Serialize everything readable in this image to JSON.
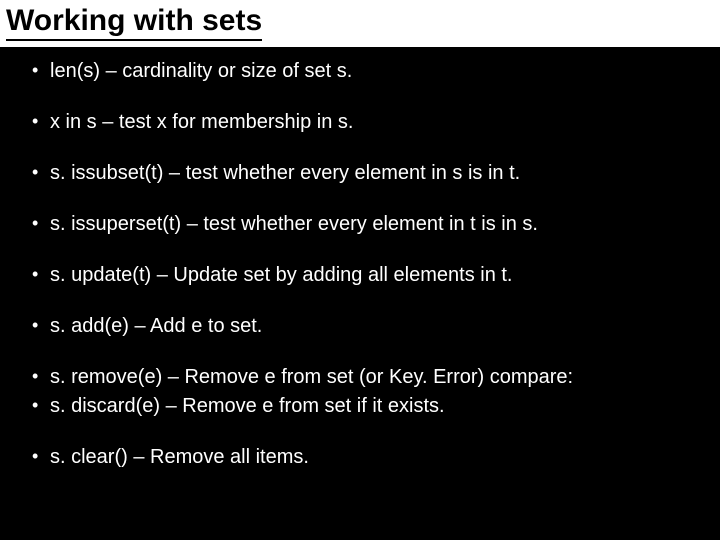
{
  "title": "Working with sets",
  "bullets": {
    "b0": "len(s) – cardinality or size of set s.",
    "b1": "x in s – test x for membership in s.",
    "b2": "s. issubset(t) – test whether every element in s is in t.",
    "b3": "s. issuperset(t) – test whether every element in t is in s.",
    "b4": "s. update(t) – Update set by adding all elements in t.",
    "b5": "s. add(e) – Add e to set.",
    "b6": "s. remove(e) – Remove e from set (or Key. Error)  compare:",
    "b7": "s. discard(e) – Remove e from set if it exists.",
    "b8": "s. clear() – Remove all items."
  }
}
